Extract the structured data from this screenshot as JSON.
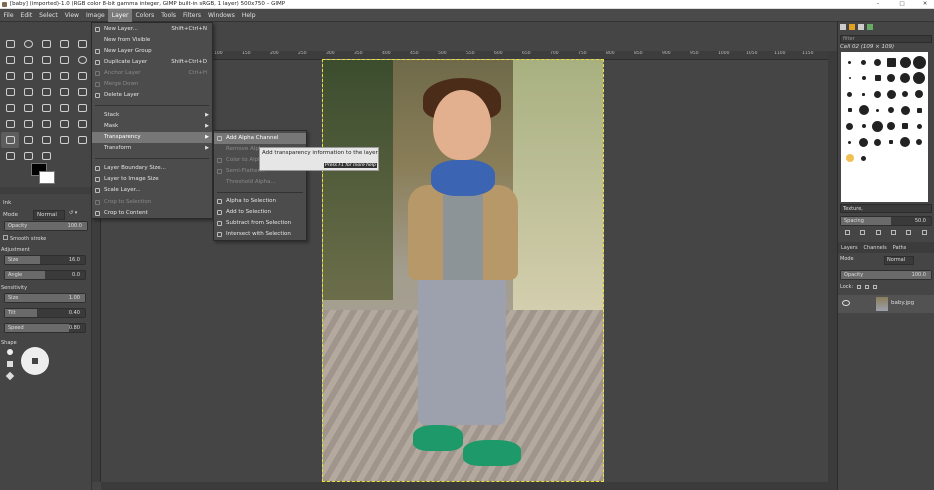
{
  "titlebar": {
    "title": "[baby] (imported)-1.0 (RGB color 8-bit gamma integer, GIMP built-in sRGB, 1 layer) 500x750 – GIMP",
    "min": "–",
    "max": "□",
    "close": "✕"
  },
  "menubar": [
    "File",
    "Edit",
    "Select",
    "View",
    "Image",
    "Layer",
    "Colors",
    "Tools",
    "Filters",
    "Windows",
    "Help"
  ],
  "layer_menu": [
    {
      "label": "New Layer...",
      "shortcut": "Shift+Ctrl+N",
      "disabled": false
    },
    {
      "label": "New from Visible",
      "shortcut": "",
      "disabled": false
    },
    {
      "label": "New Layer Group",
      "shortcut": "",
      "disabled": false
    },
    {
      "label": "Duplicate Layer",
      "shortcut": "Shift+Ctrl+D",
      "disabled": false
    },
    {
      "label": "Anchor Layer",
      "shortcut": "Ctrl+H",
      "disabled": true
    },
    {
      "label": "Merge Down",
      "shortcut": "",
      "disabled": true
    },
    {
      "label": "Delete Layer",
      "shortcut": "",
      "disabled": false
    },
    {
      "label": "Stack",
      "submenu": true
    },
    {
      "label": "Mask",
      "submenu": true
    },
    {
      "label": "Transparency",
      "submenu": true,
      "highlighted": true
    },
    {
      "label": "Transform",
      "submenu": true
    },
    {
      "label": "Layer Boundary Size...",
      "shortcut": ""
    },
    {
      "label": "Layer to Image Size",
      "shortcut": ""
    },
    {
      "label": "Scale Layer...",
      "shortcut": ""
    },
    {
      "label": "Crop to Selection",
      "shortcut": "",
      "disabled": true
    },
    {
      "label": "Crop to Content",
      "shortcut": ""
    }
  ],
  "transparency_menu": [
    {
      "label": "Add Alpha Channel",
      "highlighted": true
    },
    {
      "label": "Remove Alpha",
      "disabled": true
    },
    {
      "label": "Color to Alpha...",
      "disabled": true
    },
    {
      "label": "Semi-Flatten...",
      "disabled": true
    },
    {
      "label": "Threshold Alpha...",
      "disabled": true
    },
    {
      "label": "Alpha to Selection"
    },
    {
      "label": "Add to Selection"
    },
    {
      "label": "Subtract from Selection"
    },
    {
      "label": "Intersect with Selection"
    }
  ],
  "tooltip": {
    "text": "Add transparency information to the layer",
    "help": "Press F1 for more help"
  },
  "tool_options": {
    "title": "Ink",
    "mode_label": "Mode",
    "mode_value": "Normal",
    "opacity_label": "Opacity",
    "opacity_value": "100.0",
    "smooth_label": "Smooth stroke",
    "adjustment_label": "Adjustment",
    "size_label": "Size",
    "size_value": "16.0",
    "angle_label": "Angle",
    "angle_value": "0.0",
    "sensitivity_label": "Sensitivity",
    "sens_size_label": "Size",
    "sens_size_value": "1.00",
    "tilt_label": "Tilt",
    "tilt_value": "0.40",
    "speed_label": "Speed",
    "speed_value": "0.80",
    "shape_label": "Shape"
  },
  "ruler_ticks": [
    "100",
    "150",
    "200",
    "250",
    "300",
    "350",
    "400",
    "450",
    "500",
    "550",
    "600",
    "650",
    "700",
    "750",
    "800",
    "850",
    "900",
    "950",
    "1000",
    "1050",
    "1100",
    "1150",
    "1200",
    "1250",
    "1300"
  ],
  "dock": {
    "filter_placeholder": "filter",
    "brush_name": "Cell 02 (109 × 109)",
    "tag_label": "Texture,",
    "spacing_label": "Spacing",
    "spacing_value": "50.0",
    "tabs": [
      "Layers",
      "Channels",
      "Paths"
    ],
    "mode_label": "Mode",
    "mode_value": "Normal",
    "opacity_label": "Opacity",
    "opacity_value": "100.0",
    "lock_label": "Lock:",
    "layer_name": "baby.jpg"
  }
}
